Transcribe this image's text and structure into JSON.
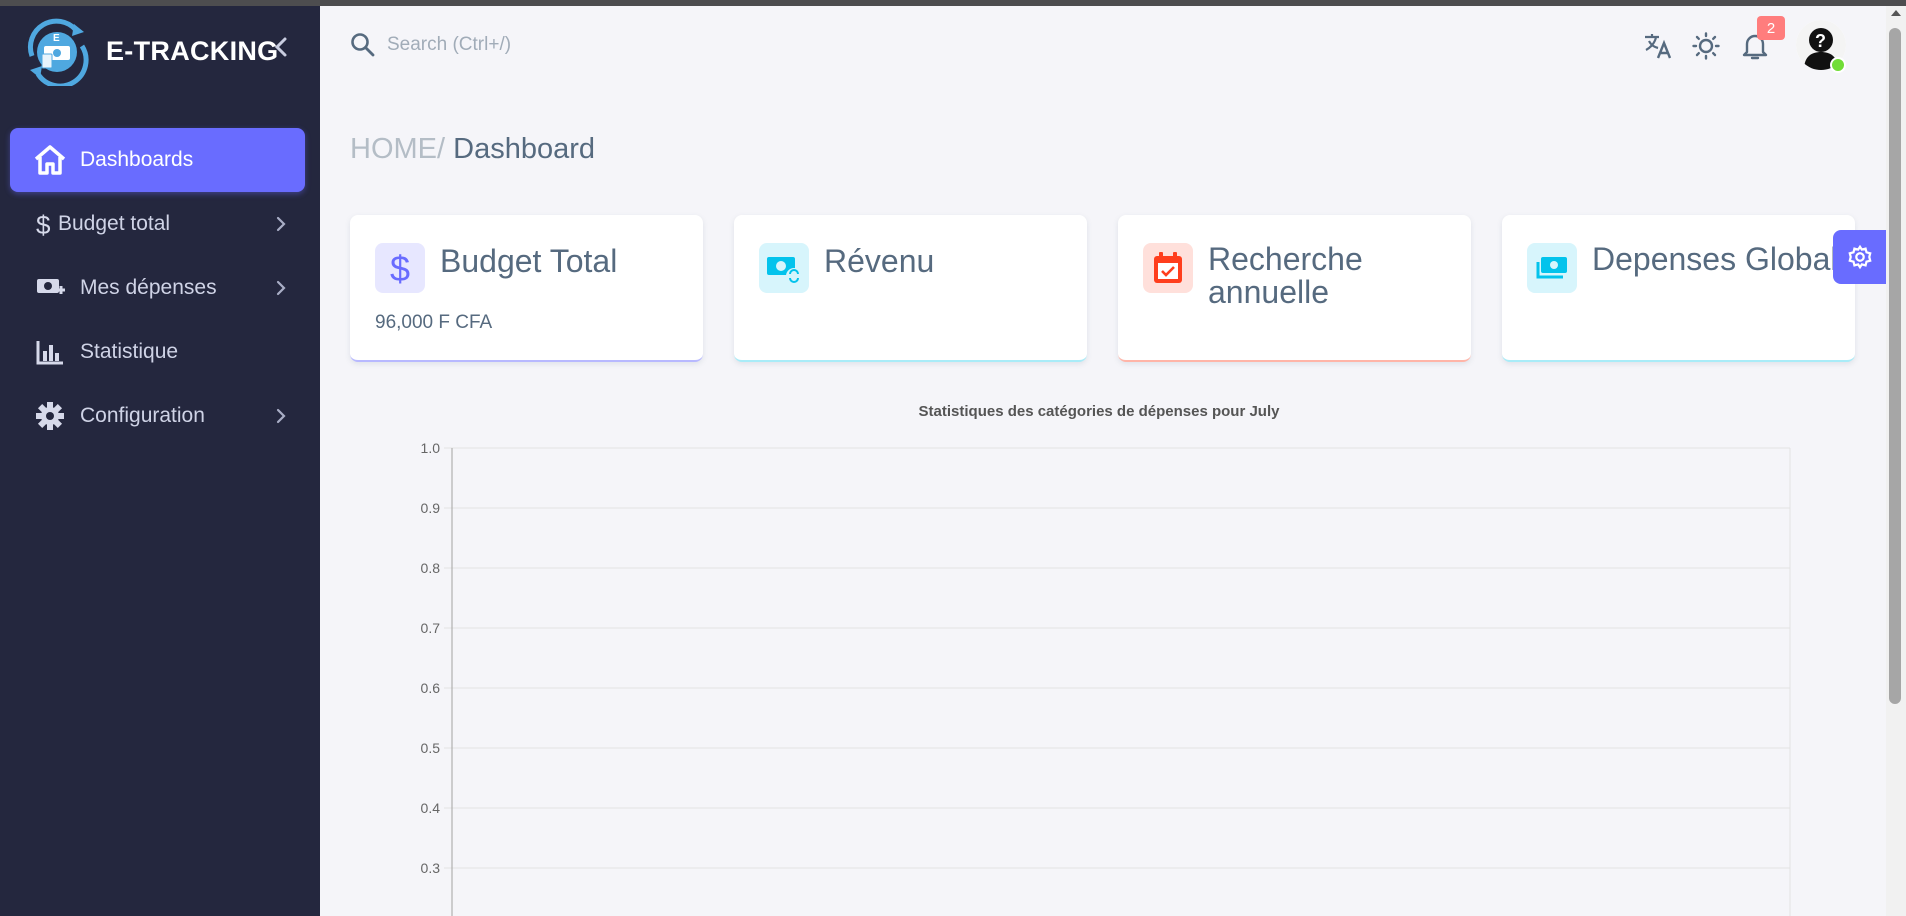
{
  "app": {
    "name": "E-TRACKING"
  },
  "sidebar": {
    "items": [
      {
        "label": "Dashboards",
        "icon": "home-icon",
        "active": true
      },
      {
        "label": "Budget total",
        "icon": "dollar-icon",
        "has_submenu": true
      },
      {
        "label": "Mes dépenses",
        "icon": "money-add-icon",
        "has_submenu": true
      },
      {
        "label": "Statistique",
        "icon": "bar-chart-icon"
      },
      {
        "label": "Configuration",
        "icon": "gear-icon",
        "has_submenu": true
      }
    ]
  },
  "navbar": {
    "search_placeholder": "Search (Ctrl+/)",
    "notification_count": "2",
    "icons": [
      "translate-icon",
      "sun-icon",
      "bell-icon",
      "avatar"
    ]
  },
  "breadcrumb": {
    "home": "HOME/",
    "current": "Dashboard"
  },
  "cards": [
    {
      "title": "Budget Total",
      "value": "96,000 F CFA",
      "icon": "dollar-icon",
      "color": "#696cff"
    },
    {
      "title": "Révenu",
      "value": "",
      "icon": "money-exchange-icon",
      "color": "#03c3ec"
    },
    {
      "title": "Recherche annuelle",
      "value": "",
      "icon": "calendar-check-icon",
      "color": "#ff3e1d"
    },
    {
      "title": "Depenses Global",
      "value": "",
      "icon": "money-icon",
      "color": "#03c3ec"
    }
  ],
  "colors": {
    "sidebar_bg": "#24273e",
    "accent": "#696cff",
    "page_bg": "#f5f5f9"
  },
  "chart_data": {
    "type": "bar",
    "title": "Statistiques des catégories de dépenses pour July",
    "categories": [],
    "values": [],
    "ylim": [
      0,
      1
    ],
    "yticks": [
      "1.0",
      "0.9",
      "0.8",
      "0.7",
      "0.6",
      "0.5",
      "0.4",
      "0.3"
    ],
    "grid": true
  }
}
